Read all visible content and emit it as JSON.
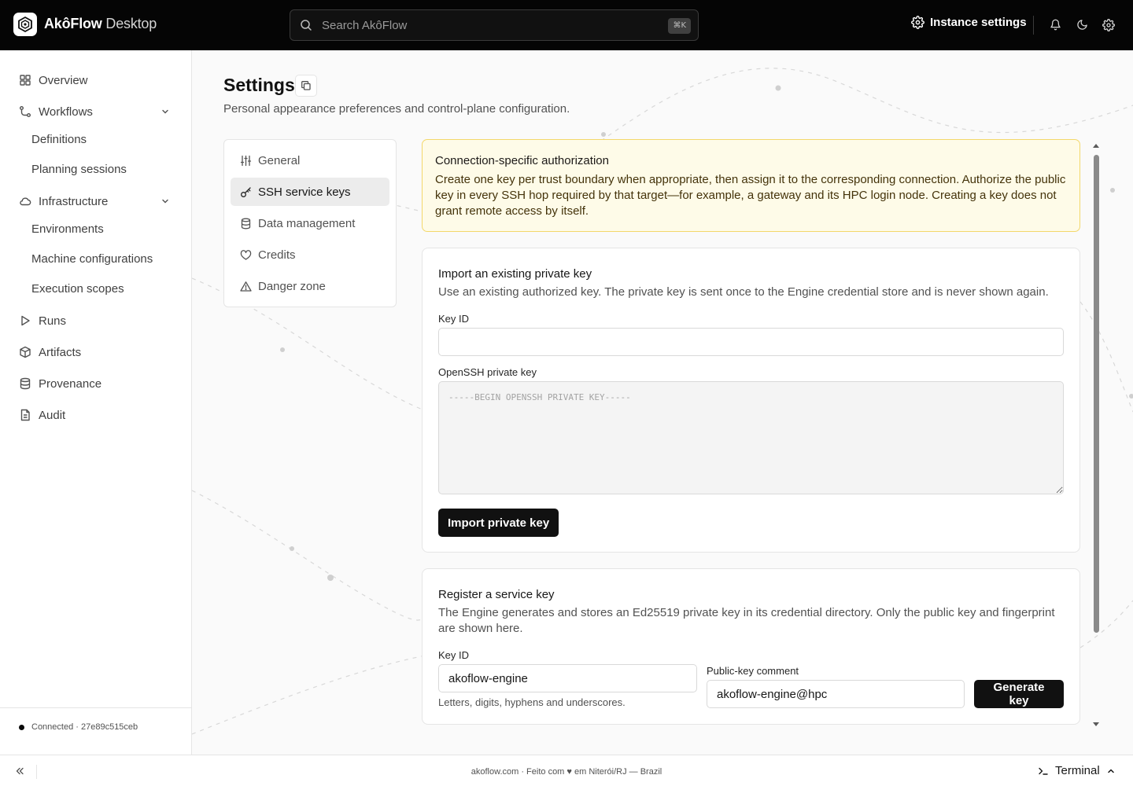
{
  "app": {
    "brand_bold": "AkôFlow",
    "brand_light": "Desktop",
    "logo_icon": "akoflow-logo-icon"
  },
  "topbar": {
    "search_placeholder": "Search AkôFlow",
    "search_shortcut": "⌘K",
    "instance_settings_label": "Instance settings",
    "icons": [
      "bell-icon",
      "moon-icon",
      "gear-icon"
    ]
  },
  "sidebar": {
    "items": [
      {
        "label": "Overview",
        "icon": "grid-icon"
      },
      {
        "label": "Workflows",
        "icon": "workflow-icon",
        "expanded": true,
        "children": [
          {
            "label": "Definitions"
          },
          {
            "label": "Planning sessions"
          }
        ]
      },
      {
        "label": "Infrastructure",
        "icon": "cloud-icon",
        "expanded": true,
        "children": [
          {
            "label": "Environments"
          },
          {
            "label": "Machine configurations"
          },
          {
            "label": "Execution scopes"
          }
        ]
      },
      {
        "label": "Runs",
        "icon": "play-icon"
      },
      {
        "label": "Artifacts",
        "icon": "box-icon"
      },
      {
        "label": "Provenance",
        "icon": "database-icon"
      },
      {
        "label": "Audit",
        "icon": "file-icon"
      }
    ],
    "connection_status": "Connected · 27e89c515ceb"
  },
  "page": {
    "title": "Settings",
    "subtitle": "Personal appearance preferences and control-plane configuration."
  },
  "settings_nav": {
    "items": [
      {
        "label": "General",
        "icon": "sliders-icon"
      },
      {
        "label": "SSH service keys",
        "icon": "key-icon",
        "active": true
      },
      {
        "label": "Data management",
        "icon": "database-icon"
      },
      {
        "label": "Credits",
        "icon": "heart-icon"
      },
      {
        "label": "Danger zone",
        "icon": "warning-icon"
      }
    ]
  },
  "notice": {
    "title": "Connection-specific authorization",
    "body": "Create one key per trust boundary when appropriate, then assign it to the corresponding connection. Authorize the public key in every SSH hop required by that target—for example, a gateway and its HPC login node. Creating a key does not grant remote access by itself."
  },
  "import_card": {
    "title": "Import an existing private key",
    "description": "Use an existing authorized key. The private key is sent once to the Engine credential store and is never shown again.",
    "key_id_label": "Key ID",
    "key_id_value": "",
    "private_key_label": "OpenSSH private key",
    "private_key_placeholder": "-----BEGIN OPENSSH PRIVATE KEY-----",
    "submit_label": "Import private key"
  },
  "register_card": {
    "title": "Register a service key",
    "description": "The Engine generates and stores an Ed25519 private key in its credential directory. Only the public key and fingerprint are shown here.",
    "key_id_label": "Key ID",
    "key_id_value": "akoflow-engine",
    "key_id_hint": "Letters, digits, hyphens and underscores.",
    "comment_label": "Public-key comment",
    "comment_value": "akoflow-engine@hpc",
    "submit_label": "Generate key"
  },
  "footer": {
    "credit": "akoflow.com · Feito com ♥ em Niterói/RJ — Brazil",
    "terminal_label": "Terminal"
  }
}
